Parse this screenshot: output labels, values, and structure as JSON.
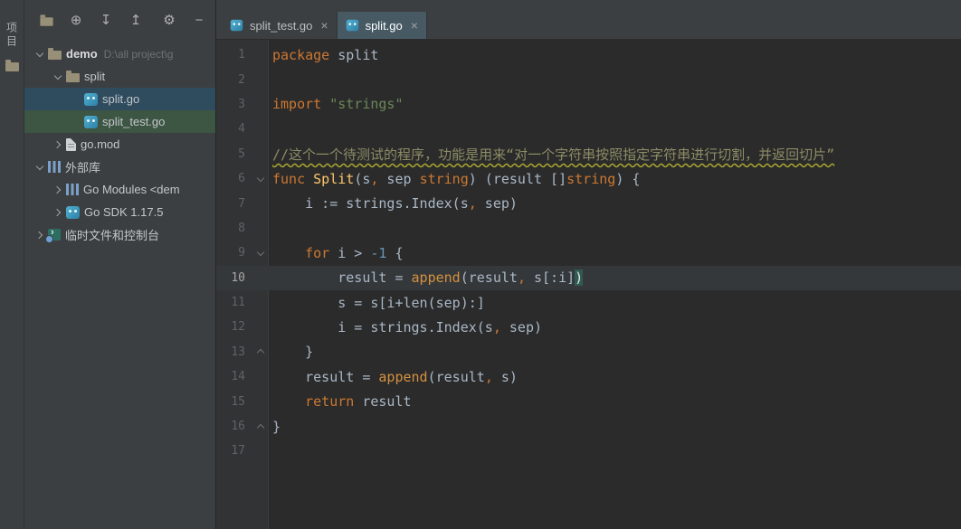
{
  "stripe": {
    "label": "项目"
  },
  "toolbar": {
    "icons": [
      {
        "name": "select-opened-file-icon",
        "glyph": "",
        "cls": "folder",
        "right": false
      },
      {
        "name": "locate-icon",
        "glyph": "⊕",
        "cls": "",
        "right": false
      },
      {
        "name": "expand-all-icon",
        "glyph": "↧",
        "cls": "",
        "right": false
      },
      {
        "name": "collapse-all-icon",
        "glyph": "↥",
        "cls": "",
        "right": false
      },
      {
        "name": "settings-icon",
        "glyph": "⚙",
        "cls": "",
        "right": true
      },
      {
        "name": "hide-panel-icon",
        "glyph": "−",
        "cls": "",
        "right": false
      }
    ]
  },
  "project_tree": {
    "items": [
      {
        "depth": 0,
        "chevron": "down",
        "icon": "folder",
        "label": "demo",
        "bold": true,
        "extra": "D:\\all project\\g",
        "bg": ""
      },
      {
        "depth": 1,
        "chevron": "down",
        "icon": "folder",
        "label": "split",
        "bold": false,
        "extra": "",
        "bg": ""
      },
      {
        "depth": 2,
        "chevron": "",
        "icon": "go-file",
        "label": "split.go",
        "bold": false,
        "extra": "",
        "bg": "#2f4b5e"
      },
      {
        "depth": 2,
        "chevron": "",
        "icon": "go-file",
        "label": "split_test.go",
        "bold": false,
        "extra": "",
        "bg": "#3d5543"
      },
      {
        "depth": 1,
        "chevron": "right",
        "icon": "file",
        "label": "go.mod",
        "bold": false,
        "extra": "",
        "bg": ""
      },
      {
        "depth": 0,
        "chevron": "down",
        "icon": "library",
        "label": "外部库",
        "bold": false,
        "extra": "",
        "bg": ""
      },
      {
        "depth": 1,
        "chevron": "right",
        "icon": "library",
        "label": "Go Modules <dem",
        "bold": false,
        "extra": "",
        "bg": ""
      },
      {
        "depth": 1,
        "chevron": "right",
        "icon": "go-sdk",
        "label": "Go SDK 1.17.5",
        "bold": false,
        "extra": "",
        "bg": ""
      },
      {
        "depth": 0,
        "chevron": "right",
        "icon": "console",
        "label": "临时文件和控制台",
        "bold": false,
        "extra": "",
        "bg": ""
      }
    ]
  },
  "tabs": {
    "items": [
      {
        "label": "split_test.go",
        "close_glyph": "×",
        "active": false
      },
      {
        "label": "split.go",
        "close_glyph": "×",
        "active": true
      }
    ]
  },
  "editor": {
    "lines": [
      {
        "num": "1",
        "fold": "",
        "cur": false,
        "tokens": [
          [
            "kw",
            "package"
          ],
          [
            "pl",
            " split"
          ]
        ]
      },
      {
        "num": "2",
        "fold": "",
        "cur": false,
        "tokens": []
      },
      {
        "num": "3",
        "fold": "",
        "cur": false,
        "tokens": [
          [
            "kw",
            "import"
          ],
          [
            "pl",
            " "
          ],
          [
            "str",
            "\"strings\""
          ]
        ]
      },
      {
        "num": "4",
        "fold": "",
        "cur": false,
        "tokens": []
      },
      {
        "num": "5",
        "fold": "",
        "cur": false,
        "tokens": [
          [
            "cm",
            "//这个一个待测试的程序，功能是用来“对一个字符串按照指定字符串进行切割，并返回切片”"
          ]
        ]
      },
      {
        "num": "6",
        "fold": "open",
        "cur": false,
        "tokens": [
          [
            "kw",
            "func"
          ],
          [
            "pl",
            " "
          ],
          [
            "fn",
            "Split"
          ],
          [
            "pl",
            "(s"
          ],
          [
            "kw",
            ","
          ],
          [
            "pl",
            " sep "
          ],
          [
            "kw",
            "string"
          ],
          [
            "pl",
            ") (result []"
          ],
          [
            "kw",
            "string"
          ],
          [
            "pl",
            ") {"
          ]
        ]
      },
      {
        "num": "7",
        "fold": "",
        "cur": false,
        "tokens": [
          [
            "pl",
            "    i := strings.Index(s"
          ],
          [
            "kw",
            ","
          ],
          [
            "pl",
            " sep)"
          ]
        ]
      },
      {
        "num": "8",
        "fold": "",
        "cur": false,
        "tokens": []
      },
      {
        "num": "9",
        "fold": "open",
        "cur": false,
        "tokens": [
          [
            "pl",
            "    "
          ],
          [
            "kw",
            "for"
          ],
          [
            "pl",
            " i > "
          ],
          [
            "num",
            "-1"
          ],
          [
            "pl",
            " {"
          ]
        ]
      },
      {
        "num": "10",
        "fold": "",
        "cur": true,
        "tokens": [
          [
            "pl",
            "        result = "
          ],
          [
            "bi",
            "append"
          ],
          [
            "pl",
            "(result"
          ],
          [
            "kw",
            ","
          ],
          [
            "pl",
            " s[:i]"
          ],
          [
            "br",
            ")"
          ]
        ]
      },
      {
        "num": "11",
        "fold": "",
        "cur": false,
        "tokens": [
          [
            "pl",
            "        s = s[i+len(sep):]"
          ]
        ]
      },
      {
        "num": "12",
        "fold": "",
        "cur": false,
        "tokens": [
          [
            "pl",
            "        i = strings.Index(s"
          ],
          [
            "kw",
            ","
          ],
          [
            "pl",
            " sep)"
          ]
        ]
      },
      {
        "num": "13",
        "fold": "close",
        "cur": false,
        "tokens": [
          [
            "pl",
            "    }"
          ]
        ]
      },
      {
        "num": "14",
        "fold": "",
        "cur": false,
        "tokens": [
          [
            "pl",
            "    result = "
          ],
          [
            "bi",
            "append"
          ],
          [
            "pl",
            "(result"
          ],
          [
            "kw",
            ","
          ],
          [
            "pl",
            " s)"
          ]
        ]
      },
      {
        "num": "15",
        "fold": "",
        "cur": false,
        "tokens": [
          [
            "pl",
            "    "
          ],
          [
            "kw",
            "return"
          ],
          [
            "pl",
            " result"
          ]
        ]
      },
      {
        "num": "16",
        "fold": "close",
        "cur": false,
        "tokens": [
          [
            "pl",
            "}"
          ]
        ]
      },
      {
        "num": "17",
        "fold": "",
        "cur": false,
        "tokens": []
      }
    ]
  }
}
